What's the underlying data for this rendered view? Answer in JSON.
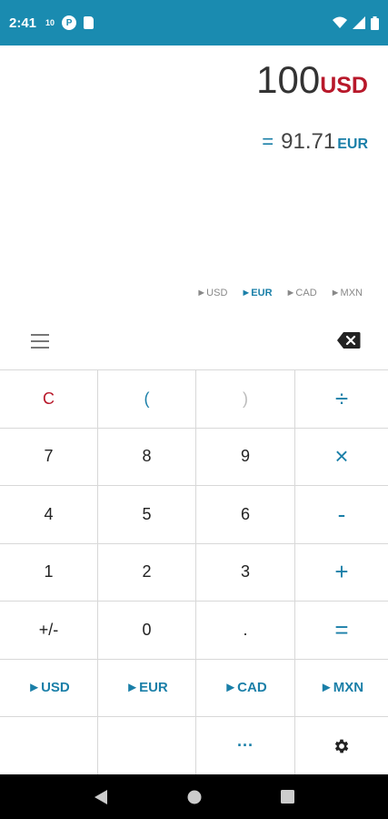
{
  "status_bar": {
    "time": "2:41",
    "small_label": "10",
    "circle_label": "P"
  },
  "display": {
    "main_value": "100",
    "main_currency": "USD",
    "result_prefix": "=",
    "result_value": "91.71",
    "result_currency": "EUR"
  },
  "currency_strip": [
    {
      "label": "►USD"
    },
    {
      "label": "►EUR"
    },
    {
      "label": "►CAD"
    },
    {
      "label": "►MXN"
    }
  ],
  "keys": {
    "clear": "C",
    "open_paren": "(",
    "close_paren": ")",
    "divide": "÷",
    "seven": "7",
    "eight": "8",
    "nine": "9",
    "multiply": "×",
    "four": "4",
    "five": "5",
    "six": "6",
    "minus": "-",
    "one": "1",
    "two": "2",
    "three": "3",
    "plus": "+",
    "negate": "+/-",
    "zero": "0",
    "decimal": ".",
    "equals": "=",
    "cur_usd": "►USD",
    "cur_eur": "►EUR",
    "cur_cad": "►CAD",
    "cur_mxn": "►MXN",
    "more": "···"
  },
  "colors": {
    "accent": "#1a7fa8",
    "clear": "#b8182a",
    "status_bar": "#1a8bb0"
  }
}
